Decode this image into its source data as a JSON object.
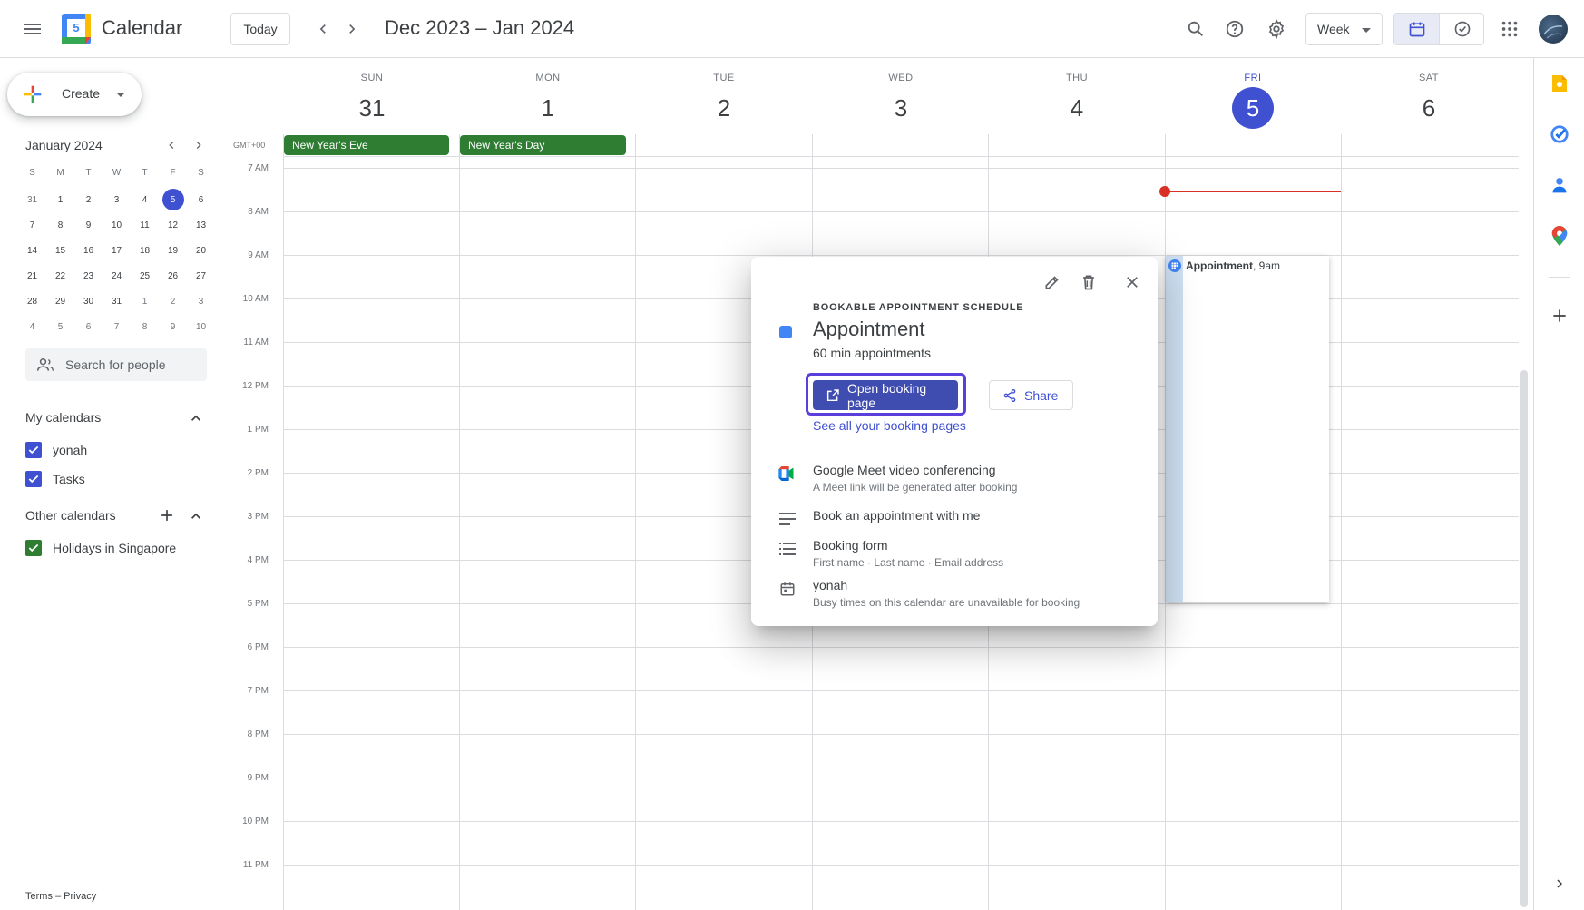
{
  "header": {
    "app_title": "Calendar",
    "logo_day": "5",
    "today_label": "Today",
    "date_range": "Dec 2023 – Jan 2024",
    "view_label": "Week"
  },
  "sidebar": {
    "create_label": "Create",
    "mini_month": "January 2024",
    "weekday_initials": [
      "S",
      "M",
      "T",
      "W",
      "T",
      "F",
      "S"
    ],
    "mini_weeks": [
      [
        "31",
        "1",
        "2",
        "3",
        "4",
        "5",
        "6"
      ],
      [
        "7",
        "8",
        "9",
        "10",
        "11",
        "12",
        "13"
      ],
      [
        "14",
        "15",
        "16",
        "17",
        "18",
        "19",
        "20"
      ],
      [
        "21",
        "22",
        "23",
        "24",
        "25",
        "26",
        "27"
      ],
      [
        "28",
        "29",
        "30",
        "31",
        "1",
        "2",
        "3"
      ],
      [
        "4",
        "5",
        "6",
        "7",
        "8",
        "9",
        "10"
      ]
    ],
    "search_people_placeholder": "Search for people",
    "my_calendars_title": "My calendars",
    "my_calendars": [
      {
        "label": "yonah",
        "color": "#3f51d1"
      },
      {
        "label": "Tasks",
        "color": "#3f51d1"
      }
    ],
    "other_calendars_title": "Other calendars",
    "other_calendars": [
      {
        "label": "Holidays in Singapore",
        "color": "#2e7d32"
      }
    ],
    "footer": "Terms – Privacy"
  },
  "grid": {
    "timezone": "GMT+00",
    "days": [
      {
        "dow": "SUN",
        "num": "31"
      },
      {
        "dow": "MON",
        "num": "1"
      },
      {
        "dow": "TUE",
        "num": "2"
      },
      {
        "dow": "WED",
        "num": "3"
      },
      {
        "dow": "THU",
        "num": "4"
      },
      {
        "dow": "FRI",
        "num": "5"
      },
      {
        "dow": "SAT",
        "num": "6"
      }
    ],
    "all_day_events": [
      {
        "label": "New Year's Eve",
        "color": "#2e7d32"
      },
      {
        "label": "New Year's Day",
        "color": "#2e7d32"
      }
    ],
    "hours": [
      "7 AM",
      "8 AM",
      "9 AM",
      "10 AM",
      "11 AM",
      "12 PM",
      "1 PM",
      "2 PM",
      "3 PM",
      "4 PM",
      "5 PM",
      "6 PM",
      "7 PM",
      "8 PM",
      "9 PM",
      "10 PM",
      "11 PM"
    ],
    "event": {
      "title": "Appointment",
      "time": ", 9am",
      "color": "#4285f4"
    }
  },
  "popover": {
    "kicker": "BOOKABLE APPOINTMENT SCHEDULE",
    "title": "Appointment",
    "subtitle": "60 min appointments",
    "open_label": "Open booking page",
    "share_label": "Share",
    "see_all_label": "See all your booking pages",
    "meet_title": "Google Meet video conferencing",
    "meet_sub": "A Meet link will be generated after booking",
    "description": "Book an appointment with me",
    "form_title": "Booking form",
    "form_sub": "First name · Last name · Email address",
    "calendar_title": "yonah",
    "calendar_sub": "Busy times on this calendar are unavailable for booking"
  },
  "colors": {
    "accent": "#3f51d1",
    "holiday": "#2e7d32",
    "now_line": "#d93025"
  }
}
